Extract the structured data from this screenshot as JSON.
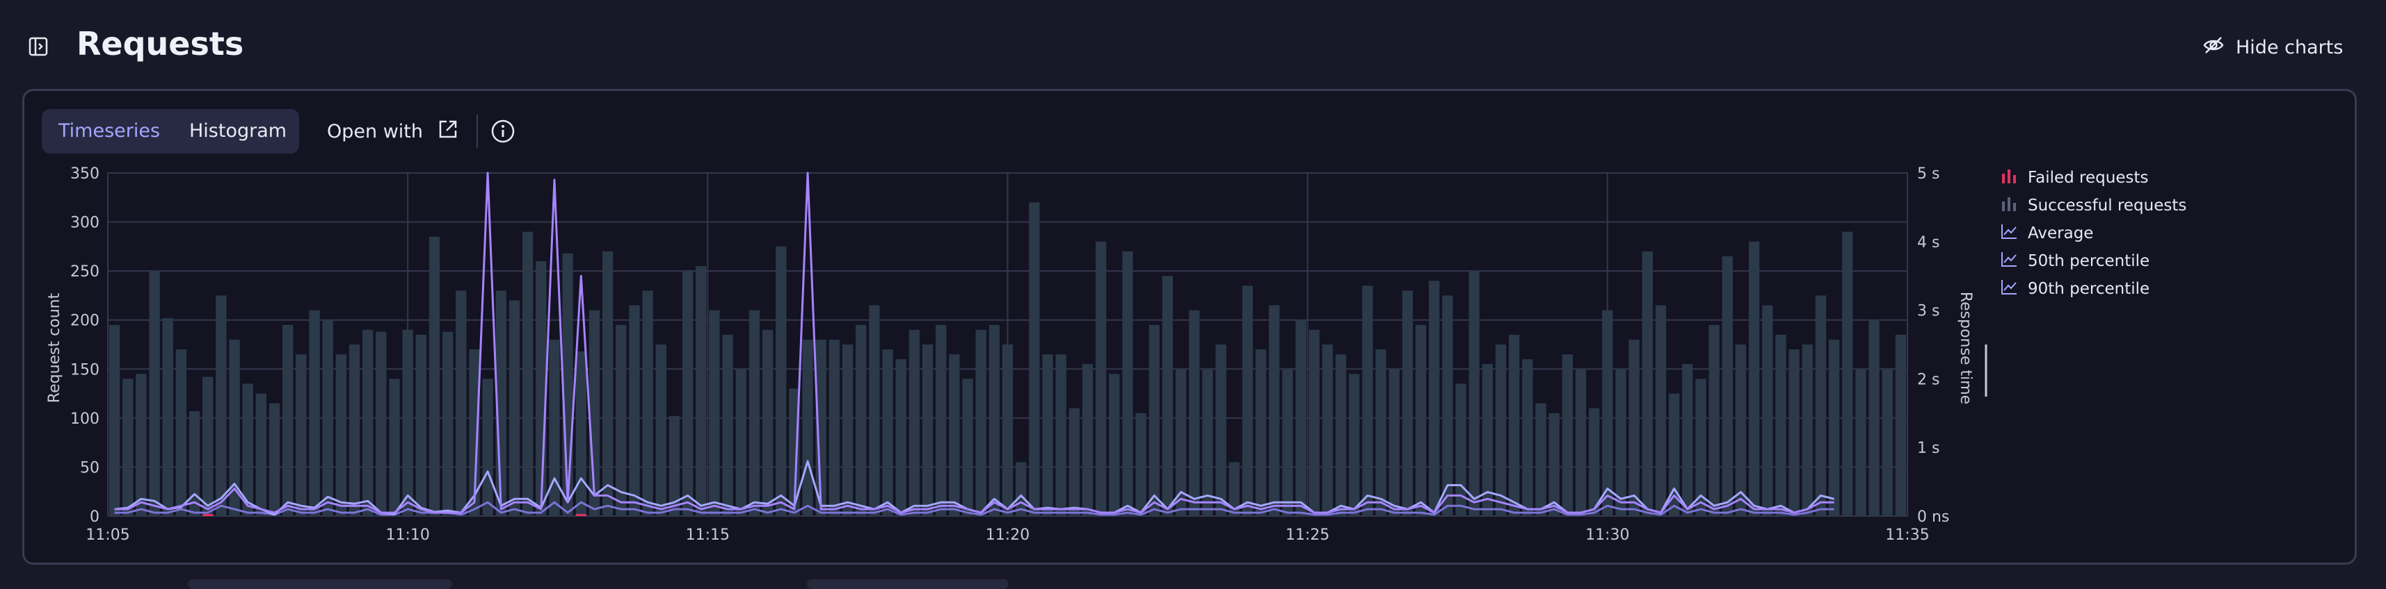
{
  "header": {
    "title": "Requests",
    "hide_charts_label": "Hide charts"
  },
  "toolbar": {
    "tabs": [
      {
        "label": "Timeseries",
        "active": true
      },
      {
        "label": "Histogram",
        "active": false
      }
    ],
    "open_with_label": "Open with"
  },
  "colors": {
    "failed": "#e0325f",
    "successful_bar": "#2b3949",
    "average": "#a5a8ff",
    "p50": "#7c73d6",
    "p90": "#a584ff"
  },
  "legend": [
    {
      "label": "Failed requests",
      "icon": "bar-chart-icon",
      "color": "#e0325f"
    },
    {
      "label": "Successful requests",
      "icon": "bar-chart-icon",
      "color": "#5b6277"
    },
    {
      "label": "Average",
      "icon": "line-chart-icon",
      "color": "#a5a8ff"
    },
    {
      "label": "50th percentile",
      "icon": "line-chart-icon",
      "color": "#a5a8ff"
    },
    {
      "label": "90th percentile",
      "icon": "line-chart-icon",
      "color": "#a5a8ff"
    }
  ],
  "chart_data": {
    "type": "bar",
    "x": [
      "11:05",
      "11:05",
      "11:05",
      "11:05",
      "11:06",
      "11:06",
      "11:06",
      "11:06",
      "11:07",
      "11:07",
      "11:07",
      "11:07",
      "11:08",
      "11:08",
      "11:08",
      "11:08",
      "11:09",
      "11:09",
      "11:09",
      "11:09",
      "11:10",
      "11:10",
      "11:10",
      "11:10",
      "11:11",
      "11:11",
      "11:11",
      "11:11",
      "11:12",
      "11:12",
      "11:12",
      "11:12",
      "11:13",
      "11:13",
      "11:13",
      "11:13",
      "11:14",
      "11:14",
      "11:14",
      "11:14",
      "11:15",
      "11:15",
      "11:15",
      "11:15",
      "11:16",
      "11:16",
      "11:16",
      "11:16",
      "11:17",
      "11:17",
      "11:17",
      "11:17",
      "11:18",
      "11:18",
      "11:18",
      "11:18",
      "11:19",
      "11:19",
      "11:19",
      "11:19",
      "11:20",
      "11:20",
      "11:20",
      "11:20",
      "11:21",
      "11:21",
      "11:21",
      "11:21",
      "11:22",
      "11:22",
      "11:22",
      "11:22",
      "11:23",
      "11:23",
      "11:23",
      "11:23",
      "11:24",
      "11:24",
      "11:24",
      "11:24",
      "11:25",
      "11:25",
      "11:25",
      "11:25",
      "11:26",
      "11:26",
      "11:26",
      "11:26",
      "11:27",
      "11:27",
      "11:27",
      "11:27",
      "11:28",
      "11:28",
      "11:28",
      "11:28",
      "11:29",
      "11:29",
      "11:29",
      "11:29",
      "11:30",
      "11:30",
      "11:30",
      "11:30",
      "11:31",
      "11:31",
      "11:31",
      "11:31",
      "11:32",
      "11:32",
      "11:32",
      "11:32",
      "11:33",
      "11:33",
      "11:33",
      "11:33",
      "11:34",
      "11:34",
      "11:34",
      "11:34"
    ],
    "x_ticks": [
      "11:05",
      "11:10",
      "11:15",
      "11:20",
      "11:25",
      "11:30",
      "11:35"
    ],
    "y_left": {
      "label": "Request count",
      "ticks": [
        "0",
        "50",
        "100",
        "150",
        "200",
        "250",
        "300",
        "350"
      ],
      "range": [
        0,
        350
      ]
    },
    "y_right": {
      "label": "Response time",
      "ticks": [
        "0 ns",
        "1 s",
        "2 s",
        "3 s",
        "4 s",
        "5 s"
      ],
      "range": [
        0,
        5
      ]
    },
    "series": [
      {
        "name": "Successful requests",
        "type": "bar",
        "values": [
          195,
          140,
          145,
          250,
          202,
          170,
          107,
          142,
          225,
          180,
          135,
          125,
          115,
          195,
          165,
          210,
          200,
          165,
          175,
          190,
          188,
          140,
          190,
          185,
          285,
          188,
          230,
          170,
          140,
          230,
          220,
          290,
          260,
          180,
          268,
          168,
          210,
          270,
          195,
          215,
          230,
          175,
          102,
          250,
          255,
          210,
          185,
          150,
          210,
          190,
          275,
          130,
          180,
          180,
          180,
          175,
          195,
          215,
          170,
          160,
          190,
          175,
          195,
          165,
          140,
          190,
          195,
          175,
          55,
          320,
          165,
          165,
          110,
          155,
          280,
          145,
          270,
          105,
          195,
          245,
          150,
          210,
          150,
          175,
          55,
          235,
          170,
          215,
          150,
          200,
          190,
          175,
          165,
          145,
          235,
          170,
          150,
          230,
          195,
          240,
          225,
          135,
          250,
          155,
          175,
          185,
          160,
          115,
          105,
          165,
          150,
          110,
          210,
          150,
          180,
          270,
          215,
          125,
          155,
          140,
          195,
          265,
          175,
          280,
          215,
          185,
          170,
          175,
          225,
          180,
          290,
          150,
          200,
          150,
          185
        ],
        "color": "#2b3949"
      },
      {
        "name": "Failed requests",
        "type": "bar",
        "values": [
          0,
          0,
          0,
          0,
          0,
          0,
          0,
          2,
          0,
          0,
          0,
          0,
          0,
          0,
          0,
          0,
          0,
          0,
          0,
          0,
          0,
          0,
          0,
          0,
          0,
          0,
          0,
          0,
          0,
          0,
          0,
          0,
          0,
          0,
          0,
          2,
          0,
          0,
          0,
          0,
          0,
          0,
          0,
          0,
          0,
          0,
          0,
          0,
          0,
          0,
          0,
          0,
          0,
          0,
          0,
          0,
          0,
          0,
          0,
          0,
          0,
          0,
          0,
          0,
          0,
          0,
          0,
          0,
          0,
          0,
          0,
          0,
          0,
          0,
          0,
          0,
          0,
          0,
          0,
          0,
          0,
          0,
          0,
          0,
          0,
          0,
          0,
          0,
          0,
          0,
          0,
          0,
          0,
          0,
          0,
          0,
          0,
          0,
          0,
          0,
          0,
          0,
          0,
          0,
          0,
          0,
          0,
          0,
          0,
          0,
          0,
          0,
          0,
          0,
          0,
          0,
          0,
          0,
          0
        ],
        "color": "#e0325f"
      },
      {
        "name": "Average",
        "type": "line",
        "values": [
          0.1,
          0.12,
          0.25,
          0.22,
          0.1,
          0.13,
          0.32,
          0.15,
          0.26,
          0.47,
          0.2,
          0.1,
          0.02,
          0.2,
          0.15,
          0.12,
          0.28,
          0.2,
          0.18,
          0.22,
          0.05,
          0.03,
          0.3,
          0.12,
          0.06,
          0.08,
          0.05,
          0.3,
          0.65,
          0.15,
          0.25,
          0.25,
          0.12,
          0.55,
          0.2,
          0.55,
          0.3,
          0.45,
          0.35,
          0.3,
          0.2,
          0.15,
          0.2,
          0.3,
          0.15,
          0.2,
          0.15,
          0.1,
          0.2,
          0.18,
          0.3,
          0.15,
          0.8,
          0.15,
          0.15,
          0.2,
          0.15,
          0.1,
          0.2,
          0.05,
          0.15,
          0.15,
          0.2,
          0.2,
          0.1,
          0.05,
          0.25,
          0.1,
          0.3,
          0.1,
          0.12,
          0.1,
          0.12,
          0.1,
          0.05,
          0.05,
          0.15,
          0.05,
          0.3,
          0.1,
          0.35,
          0.25,
          0.3,
          0.25,
          0.1,
          0.2,
          0.15,
          0.2,
          0.2,
          0.2,
          0.05,
          0.05,
          0.15,
          0.1,
          0.3,
          0.25,
          0.15,
          0.1,
          0.2,
          0.05,
          0.45,
          0.45,
          0.25,
          0.35,
          0.3,
          0.2,
          0.1,
          0.1,
          0.2,
          0.05,
          0.05,
          0.1,
          0.4,
          0.25,
          0.3,
          0.1,
          0.05,
          0.4,
          0.1,
          0.3,
          0.15,
          0.2,
          0.35,
          0.15,
          0.1,
          0.15,
          0.05,
          0.1,
          0.3,
          0.25
        ],
        "color": "#a5a8ff"
      },
      {
        "name": "50th percentile",
        "type": "line",
        "values": [
          0.05,
          0.05,
          0.1,
          0.05,
          0.05,
          0.1,
          0.05,
          0.05,
          0.15,
          0.1,
          0.05,
          0.05,
          0.02,
          0.1,
          0.05,
          0.05,
          0.1,
          0.05,
          0.05,
          0.1,
          0.02,
          0.02,
          0.1,
          0.05,
          0.05,
          0.05,
          0.02,
          0.1,
          0.2,
          0.05,
          0.1,
          0.05,
          0.05,
          0.2,
          0.05,
          0.2,
          0.1,
          0.15,
          0.1,
          0.1,
          0.05,
          0.05,
          0.1,
          0.1,
          0.05,
          0.05,
          0.05,
          0.05,
          0.1,
          0.05,
          0.1,
          0.05,
          0.15,
          0.05,
          0.05,
          0.05,
          0.05,
          0.05,
          0.1,
          0.02,
          0.05,
          0.05,
          0.1,
          0.1,
          0.05,
          0.02,
          0.1,
          0.05,
          0.1,
          0.05,
          0.05,
          0.05,
          0.05,
          0.05,
          0.02,
          0.02,
          0.05,
          0.02,
          0.1,
          0.05,
          0.1,
          0.1,
          0.1,
          0.1,
          0.05,
          0.05,
          0.05,
          0.1,
          0.05,
          0.05,
          0.02,
          0.02,
          0.05,
          0.05,
          0.1,
          0.1,
          0.05,
          0.05,
          0.05,
          0.02,
          0.15,
          0.15,
          0.1,
          0.1,
          0.1,
          0.05,
          0.05,
          0.05,
          0.1,
          0.02,
          0.02,
          0.05,
          0.15,
          0.1,
          0.1,
          0.05,
          0.02,
          0.15,
          0.05,
          0.1,
          0.05,
          0.05,
          0.1,
          0.05,
          0.05,
          0.05,
          0.02,
          0.05,
          0.1,
          0.1
        ],
        "color": "#7c73d6"
      },
      {
        "name": "90th percentile",
        "type": "line",
        "values": [
          0.1,
          0.1,
          0.2,
          0.15,
          0.1,
          0.15,
          0.2,
          0.1,
          0.2,
          0.4,
          0.15,
          0.1,
          0.05,
          0.15,
          0.1,
          0.1,
          0.2,
          0.15,
          0.15,
          0.15,
          0.05,
          0.05,
          0.2,
          0.1,
          0.05,
          0.05,
          0.05,
          0.2,
          5.0,
          0.1,
          0.2,
          0.2,
          0.1,
          4.9,
          0.2,
          3.5,
          0.3,
          0.3,
          0.2,
          0.2,
          0.15,
          0.1,
          0.15,
          0.2,
          0.1,
          0.15,
          0.1,
          0.1,
          0.15,
          0.15,
          0.2,
          0.1,
          5.0,
          0.1,
          0.1,
          0.15,
          0.1,
          0.1,
          0.15,
          0.05,
          0.1,
          0.1,
          0.15,
          0.15,
          0.1,
          0.05,
          0.2,
          0.1,
          0.2,
          0.1,
          0.1,
          0.1,
          0.1,
          0.1,
          0.05,
          0.05,
          0.1,
          0.05,
          0.2,
          0.1,
          0.25,
          0.2,
          0.2,
          0.2,
          0.1,
          0.15,
          0.1,
          0.15,
          0.15,
          0.15,
          0.05,
          0.05,
          0.1,
          0.1,
          0.2,
          0.2,
          0.1,
          0.1,
          0.15,
          0.05,
          0.3,
          0.3,
          0.2,
          0.25,
          0.2,
          0.15,
          0.1,
          0.1,
          0.15,
          0.05,
          0.05,
          0.1,
          0.3,
          0.2,
          0.2,
          0.1,
          0.05,
          0.3,
          0.1,
          0.2,
          0.1,
          0.15,
          0.25,
          0.1,
          0.1,
          0.1,
          0.05,
          0.1,
          0.2,
          0.2
        ],
        "color": "#a584ff"
      }
    ],
    "grid": true,
    "legend_position": "right"
  }
}
